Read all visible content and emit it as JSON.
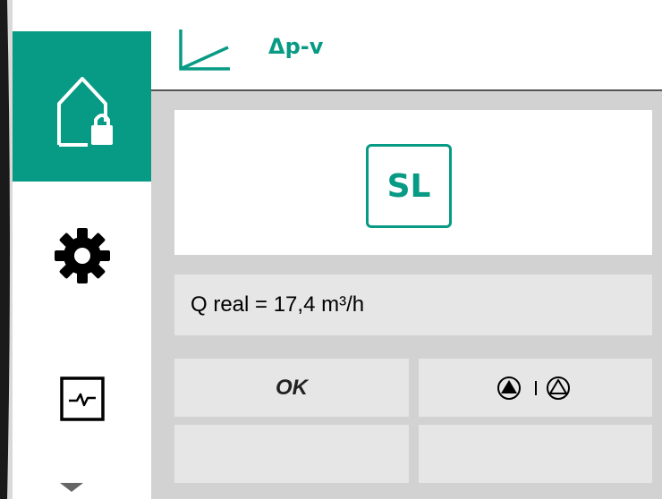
{
  "header": {
    "mode_icon": "control-curve-icon",
    "mode_title": "Δp-v"
  },
  "sidebar": {
    "items": [
      {
        "icon": "home-lock-icon",
        "active": true
      },
      {
        "icon": "gear-icon",
        "active": false
      },
      {
        "icon": "diagnostics-icon",
        "active": false
      }
    ],
    "more_icon": "chevron-down-icon"
  },
  "main": {
    "mode_badge": "SL",
    "flow_readout": "Q real = 17,4 m³/h",
    "buttons": {
      "ok_label": "OK",
      "pump_icon": "pump-switch-icon"
    }
  },
  "colors": {
    "accent": "#079a84",
    "panel": "#e6e6e6",
    "background": "#d2d2d2"
  }
}
